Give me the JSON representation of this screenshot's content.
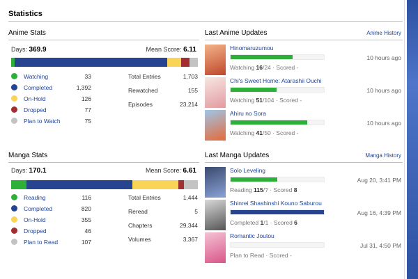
{
  "page": {
    "title": "Statistics"
  },
  "colors": {
    "watching": "#2db039",
    "completed": "#26448f",
    "on_hold": "#f9d457",
    "dropped": "#a12f31",
    "plan": "#c3c3c3",
    "link": "#1d439b"
  },
  "anime": {
    "heading": "Anime Stats",
    "days_label": "Days:",
    "days": "369.9",
    "mean_label": "Mean Score:",
    "mean": "6.11",
    "legend": [
      {
        "label": "Watching",
        "value": "33",
        "color": "#2db039"
      },
      {
        "label": "Completed",
        "value": "1,392",
        "color": "#26448f"
      },
      {
        "label": "On-Hold",
        "value": "126",
        "color": "#f9d457"
      },
      {
        "label": "Dropped",
        "value": "77",
        "color": "#a12f31"
      },
      {
        "label": "Plan to Watch",
        "value": "75",
        "color": "#c3c3c3"
      }
    ],
    "bar": [
      33,
      1392,
      126,
      77,
      75
    ],
    "totals": [
      {
        "label": "Total Entries",
        "value": "1,703"
      },
      {
        "label": "Rewatched",
        "value": "155"
      },
      {
        "label": "Episodes",
        "value": "23,214"
      }
    ]
  },
  "manga": {
    "heading": "Manga Stats",
    "days_label": "Days:",
    "days": "170.1",
    "mean_label": "Mean Score:",
    "mean": "6.61",
    "legend": [
      {
        "label": "Reading",
        "value": "116",
        "color": "#2db039"
      },
      {
        "label": "Completed",
        "value": "820",
        "color": "#26448f"
      },
      {
        "label": "On-Hold",
        "value": "355",
        "color": "#f9d457"
      },
      {
        "label": "Dropped",
        "value": "46",
        "color": "#a12f31"
      },
      {
        "label": "Plan to Read",
        "value": "107",
        "color": "#c3c3c3"
      }
    ],
    "bar": [
      116,
      820,
      355,
      46,
      107
    ],
    "totals": [
      {
        "label": "Total Entries",
        "value": "1,444"
      },
      {
        "label": "Reread",
        "value": "5"
      },
      {
        "label": "Chapters",
        "value": "29,344"
      },
      {
        "label": "Volumes",
        "value": "3,367"
      }
    ]
  },
  "anime_updates": {
    "heading": "Last Anime Updates",
    "history_link": "Anime History",
    "items": [
      {
        "title": "Hinomaruzumou",
        "status_prefix": "Watching",
        "progress": "16",
        "total": "/24",
        "score_text": " · Scored -",
        "fraction": 0.667,
        "fill": "#2db039",
        "time": "10 hours ago",
        "cover": [
          "#f2b48a",
          "#c0462b"
        ]
      },
      {
        "title": "Chi's Sweet Home: Atarashii Ouchi",
        "status_prefix": "Watching",
        "progress": "51",
        "total": "/104",
        "score_text": " · Scored -",
        "fraction": 0.49,
        "fill": "#2db039",
        "time": "10 hours ago",
        "cover": [
          "#f6e7e2",
          "#e39aa0"
        ]
      },
      {
        "title": "Ahiru no Sora",
        "status_prefix": "Watching",
        "progress": "41",
        "total": "/50",
        "score_text": " · Scored -",
        "fraction": 0.82,
        "fill": "#2db039",
        "time": "10 hours ago",
        "cover": [
          "#9ec6e8",
          "#e56a3a"
        ]
      }
    ]
  },
  "manga_updates": {
    "heading": "Last Manga Updates",
    "history_link": "Manga History",
    "items": [
      {
        "title": "Solo Leveling",
        "status_prefix": "Reading",
        "progress": "115",
        "total": "/?",
        "score_label": " · Scored ",
        "score": "8",
        "fraction": 0.5,
        "fill": "#2db039",
        "time": "Aug 20, 3:41 PM",
        "cover": [
          "#3b4a6e",
          "#8aa2d6"
        ]
      },
      {
        "title": "Shinrei Shashinshi Kouno Saburou",
        "status_prefix": "Completed",
        "progress": "1",
        "total": "/1",
        "score_label": " · Scored ",
        "score": "6",
        "fraction": 1.0,
        "fill": "#26448f",
        "time": "Aug 16, 4:39 PM",
        "cover": [
          "#d8d8d8",
          "#555555"
        ]
      },
      {
        "title": "Romantic Joutou",
        "status_prefix": "Plan to Read",
        "progress": "",
        "total": "",
        "score_label": " · Scored -",
        "score": "",
        "fraction": 0,
        "fill": "#c3c3c3",
        "time": "Jul 31, 4:50 PM",
        "cover": [
          "#f4c3d3",
          "#d9558a"
        ]
      }
    ]
  }
}
